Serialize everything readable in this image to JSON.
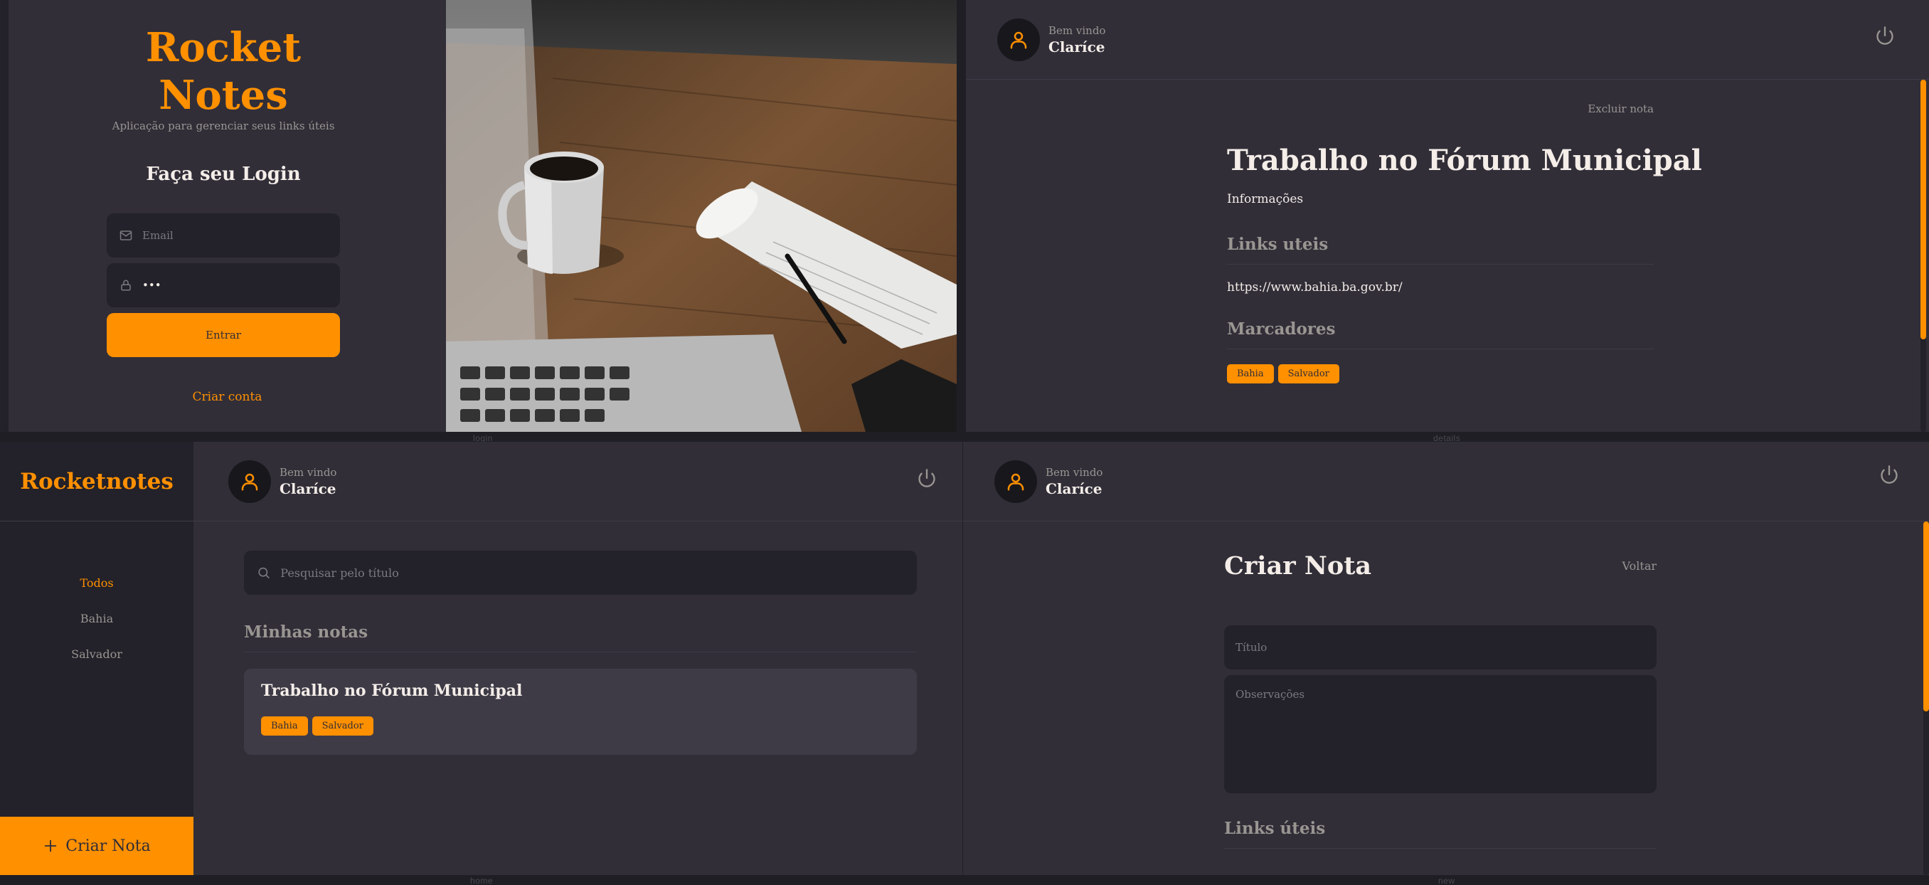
{
  "labels": {
    "login": "login",
    "details": "details",
    "home": "home",
    "new": "new"
  },
  "login": {
    "brand": "Rocket Notes",
    "tagline": "Aplicação para gerenciar seus links úteis",
    "heading": "Faça seu Login",
    "email_placeholder": "Email",
    "password_value": "•••",
    "submit_label": "Entrar",
    "create_account_label": "Criar conta"
  },
  "header": {
    "welcome": "Bem vindo",
    "user_name": "Claríce"
  },
  "details": {
    "delete_label": "Excluir nota",
    "title": "Trabalho no Fórum Municipal",
    "info": "Informações",
    "links_heading": "Links uteis",
    "link": "https://www.bahia.ba.gov.br/",
    "tags_heading": "Marcadores",
    "tags": [
      "Bahia",
      "Salvador"
    ]
  },
  "home": {
    "brand": "Rocketnotes",
    "menu": [
      "Todos",
      "Bahia",
      "Salvador"
    ],
    "active_menu": "Todos",
    "search_placeholder": "Pesquisar pelo título",
    "section_title": "Minhas notas",
    "notes": [
      {
        "title": "Trabalho no Fórum Municipal",
        "tags": [
          "Bahia",
          "Salvador"
        ]
      }
    ],
    "new_note_label": "Criar Nota"
  },
  "new_note": {
    "title": "Criar Nota",
    "back_label": "Voltar",
    "title_placeholder": "Título",
    "observations_placeholder": "Observações",
    "links_heading": "Links úteis"
  },
  "colors": {
    "accent": "#ff9000",
    "background": "#312e38",
    "surface": "#232129",
    "card": "#3e3b47",
    "text": "#f4ede8",
    "muted": "#999591"
  },
  "icons": [
    "mail-icon",
    "lock-icon",
    "user-icon",
    "power-icon",
    "search-icon",
    "plus-icon"
  ]
}
